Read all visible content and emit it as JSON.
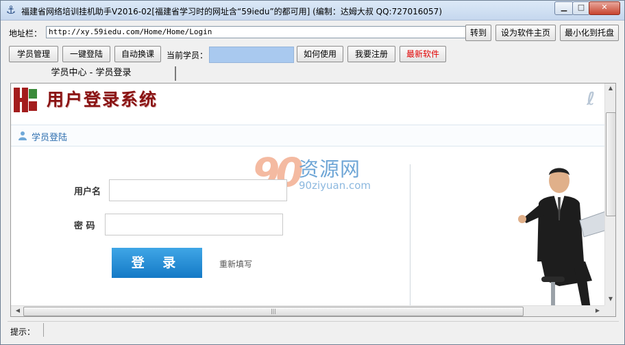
{
  "window": {
    "title": "福建省网络培训挂机助手V2016-02[福建省学习时的网址含“59iedu”的都可用] (编制：达姆大叔 QQ:727016057)",
    "app_icon": "anchor-icon"
  },
  "address_bar": {
    "label": "地址栏：",
    "url": "http://xy.59iedu.com/Home/Home/Login",
    "go_label": "转到",
    "set_home_label": "设为软件主页",
    "minimize_tray_label": "最小化到托盘"
  },
  "toolbar": {
    "student_mgmt": "学员管理",
    "one_click_login": "一键登陆",
    "auto_switch": "自动换课",
    "current_student_label": "当前学员：",
    "current_student_value": "",
    "how_to_use": "如何使用",
    "register": "我要注册",
    "new_software": "最新软件",
    "new_software_color": "#e00000"
  },
  "tab": {
    "label": "学员中心 - 学员登录"
  },
  "page": {
    "site_title": "用户登录系统",
    "section_label": "学员登陆",
    "watermark_num": "90",
    "watermark_cn": "资源网",
    "watermark_en": "90ziyuan.com",
    "username_label": "用户名",
    "password_label": "密 码",
    "login_button": "登 录",
    "reset_link": "重新填写"
  },
  "status": {
    "label": "提示："
  }
}
